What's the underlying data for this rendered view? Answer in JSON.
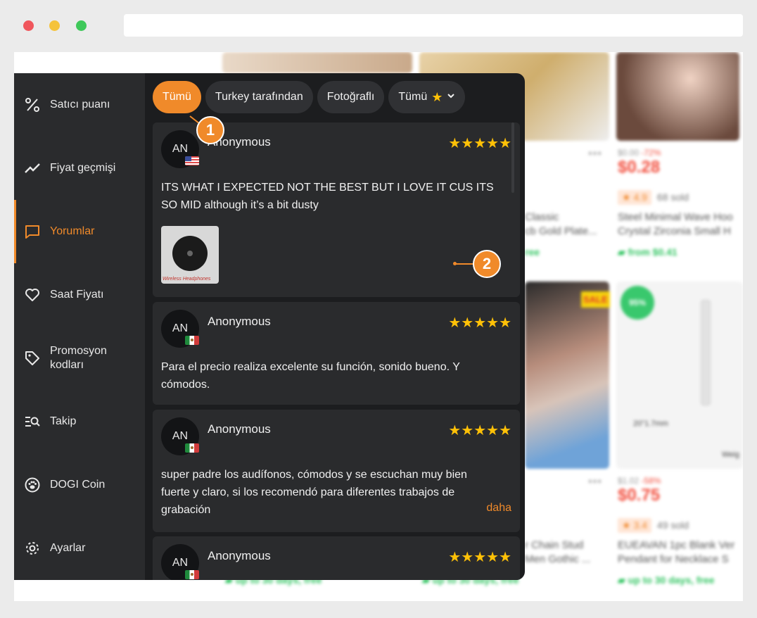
{
  "sidebar": {
    "items": [
      {
        "label": "Satıcı puanı",
        "icon": "percent-icon"
      },
      {
        "label": "Fiyat geçmişi",
        "icon": "chart-line-icon"
      },
      {
        "label": "Yorumlar",
        "icon": "comment-icon",
        "active": true
      },
      {
        "label": "Saat Fiyatı",
        "icon": "heart-icon"
      },
      {
        "label": "Promosyon kodları",
        "icon": "tag-icon"
      },
      {
        "label": "Takip",
        "icon": "track-list-icon"
      },
      {
        "label": "DOGI Coin",
        "icon": "paw-icon"
      },
      {
        "label": "Ayarlar",
        "icon": "gear-icon"
      }
    ]
  },
  "filters": {
    "all": "Tümü",
    "from_country": "Turkey tarafından",
    "with_photo": "Fotoğraflı",
    "rating_select": "Tümü"
  },
  "reviews": [
    {
      "initials": "AN",
      "name": "Anonymous",
      "flag": "us",
      "stars": "★★★★★",
      "text": "ITS WHAT I EXPECTED NOT THE BEST BUT I LOVE IT CUS ITS SO MID although it’s a bit dusty",
      "photo_caption": "Wireless Headphones"
    },
    {
      "initials": "AN",
      "name": "Anonymous",
      "flag": "mx",
      "stars": "★★★★★",
      "text": "Para el precio realiza excelente su función, sonido bueno. Y cómodos."
    },
    {
      "initials": "AN",
      "name": "Anonymous",
      "flag": "mx",
      "stars": "★★★★★",
      "text": "super padre los audífonos, cómodos y se escuchan muy bien fuerte y claro, si los recomendó para diferentes trabajos de grabación",
      "more": "daha"
    },
    {
      "initials": "AN",
      "name": "Anonymous",
      "flag": "mx",
      "stars": "★★★★★"
    }
  ],
  "callouts": [
    "1",
    "2"
  ],
  "background": {
    "price_1": "$0.28",
    "old_1": "$0.00",
    "disc_1": "-72%",
    "rating_1": "★ 4.9",
    "sold_1": "68 sold",
    "title_1a": "Steel Minimal Wave Hoo",
    "title_1b": "Crystal Zirconia Small H",
    "ship_1": "from $0.41",
    "title_0a": "Classic",
    "title_0b": "cb Gold Plate...",
    "ship_0": "ree",
    "sale_badge": "SALE",
    "circle_badge": "95%",
    "size_label": "20\"1.7mm",
    "weight_label": "Weig",
    "price_2": "$0.75",
    "old_2": "$1.02",
    "disc_2": "-58%",
    "rating_2": "★ 3.4",
    "sold_2": "49 sold",
    "title_2a": "EUEAVAN 1pc Blank Ver",
    "title_2b": "Pendant for Necklace S",
    "title_3a": "r Chain Stud",
    "title_3b": "Men Gothic ...",
    "ship_2": "up to 30 days, free",
    "ship_3": "up to 30 days, free",
    "ship_4": "up to 30 days, free"
  }
}
